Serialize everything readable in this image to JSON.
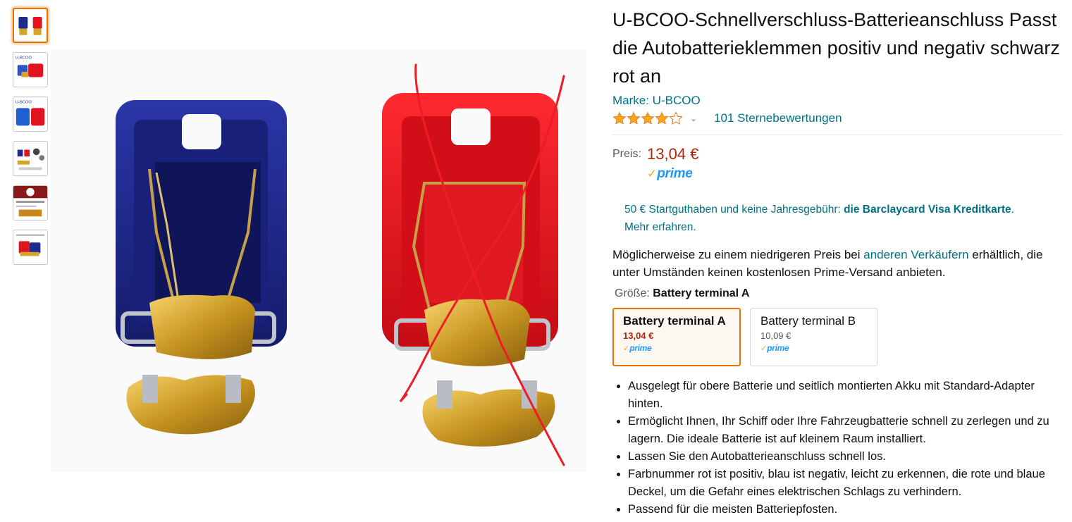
{
  "title": "U-BCOO-Schnellverschluss-Batterieanschluss Passt die Autobatterieklemmen positiv und negativ schwarz rot an",
  "brand_link": "Marke: U-BCOO",
  "rating": {
    "stars": 4,
    "max": 5,
    "count_text": "101 Sternebewertungen",
    "chevron": "⌄"
  },
  "price": {
    "label": "Preis:",
    "value": "13,04 €",
    "prime_check": "✓",
    "prime_word": "prime"
  },
  "promo": {
    "text": "50 € Startguthaben und keine Jahresgebühr: ",
    "bold_link": "die Barclaycard Visa Kreditkarte",
    "period": ".",
    "more_link": "Mehr erfahren."
  },
  "lower_price": {
    "before": "Möglicherweise zu einem niedrigeren Preis bei ",
    "link": "anderen Verkäufern",
    "after": " erhältlich, die unter Umständen keinen kostenlosen Prime-Versand anbieten."
  },
  "size": {
    "label": "Größe: ",
    "value": "Battery terminal A"
  },
  "swatches": [
    {
      "name": "Battery terminal A",
      "price": "13,04 €",
      "prime": "prime"
    },
    {
      "name": "Battery terminal B",
      "price": "10,09 €",
      "prime": "prime"
    }
  ],
  "bullets": [
    "Ausgelegt für obere Batterie und seitlich montierten Akku mit Standard-Adapter hinten.",
    "Ermöglicht Ihnen, Ihr Schiff oder Ihre Fahrzeugbatterie schnell zu zerlegen und zu lagern. Die ideale Batterie ist auf kleinem Raum installiert.",
    "Lassen Sie den Autobatterieanschluss schnell los.",
    "Farbnummer rot ist positiv, blau ist negativ, leicht zu erkennen, die rote und blaue Deckel, um die Gefahr eines elektrischen Schlags zu verhindern.",
    "Passend für die meisten Batteriepfosten."
  ],
  "thumbnails": {
    "logo_text": "U-BCOO",
    "items": [
      "thumb-blue-red-terminals",
      "thumb-logo-terminals",
      "thumb-logo-caps",
      "thumb-accessories",
      "thumb-infographic",
      "thumb-dimensions"
    ],
    "active_index": 0
  },
  "colors": {
    "link": "#007185",
    "price": "#b12704",
    "star": "#ffa41c",
    "accent": "#e77600",
    "prime": "#1a98ff",
    "cap_blue": "#1f2a8c",
    "cap_red": "#e0141e",
    "brass": "#d4a52a"
  }
}
